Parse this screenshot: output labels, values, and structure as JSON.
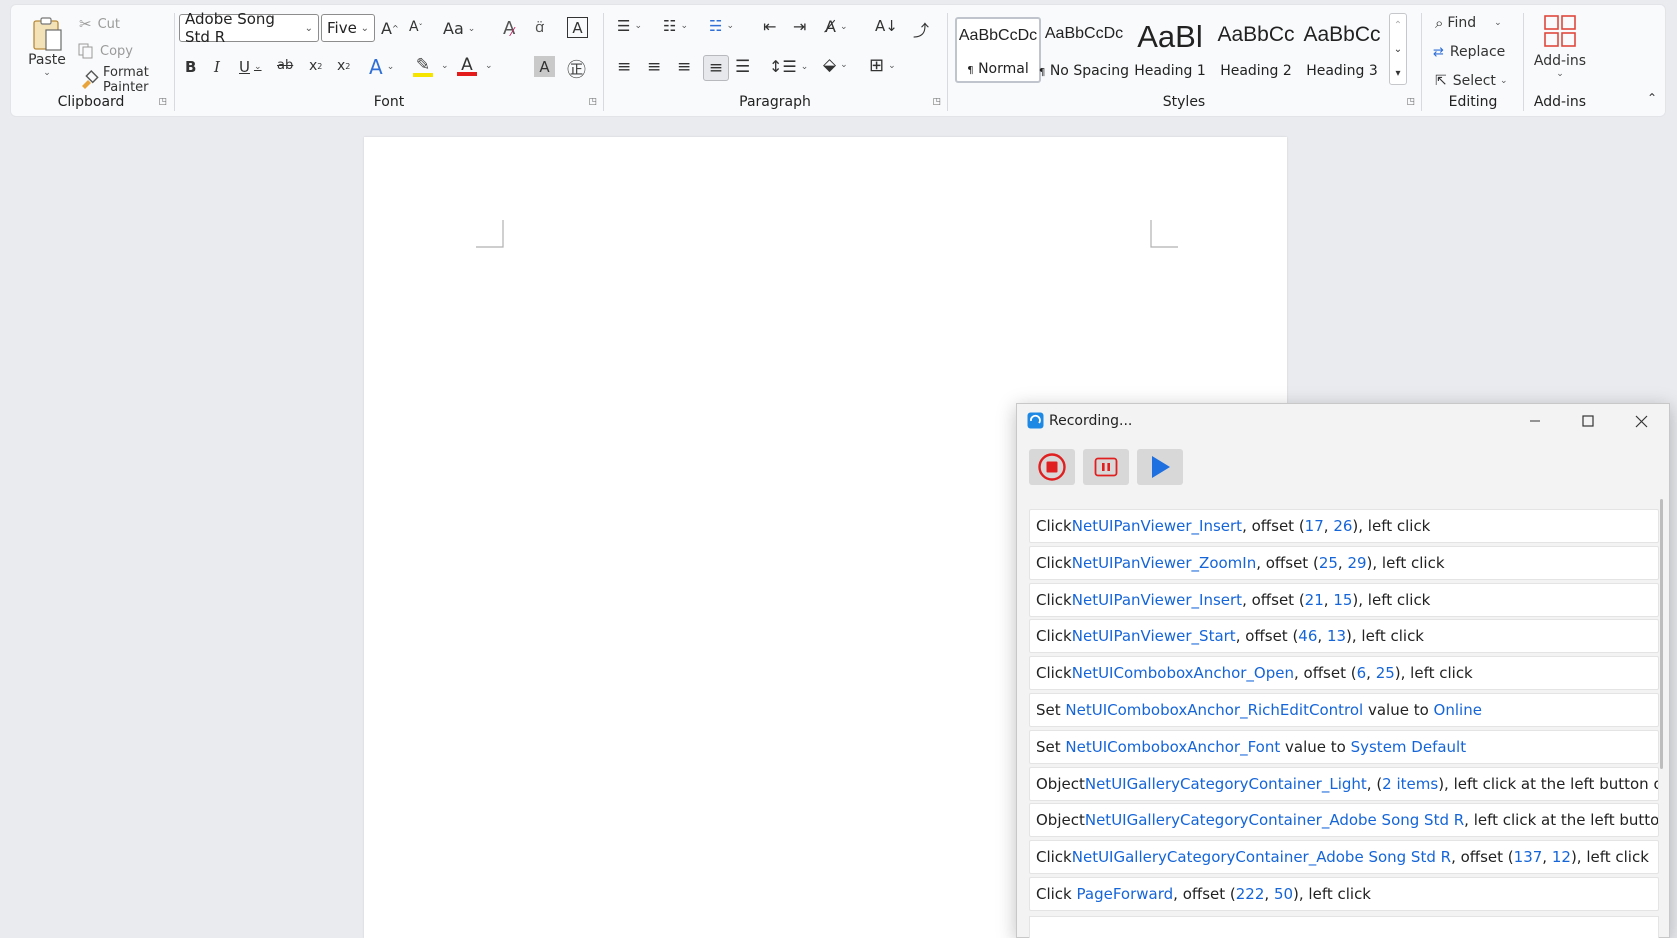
{
  "ribbon": {
    "clipboard": {
      "label": "Clipboard",
      "paste": "Paste",
      "cut": "Cut",
      "copy": "Copy",
      "format_painter_1": "Format",
      "format_painter_2": "Painter"
    },
    "font": {
      "label": "Font",
      "font_name": "Adobe Song Std R",
      "font_size": "Five",
      "change_case": "Aa"
    },
    "paragraph": {
      "label": "Paragraph"
    },
    "styles": {
      "label": "Styles",
      "items": [
        {
          "preview": "AaBbCcDc",
          "name": "Normal",
          "marker": "¶"
        },
        {
          "preview": "AaBbCcDc",
          "name": "No Spacing",
          "marker": "¶"
        },
        {
          "preview": "AaBl",
          "name": "Heading 1"
        },
        {
          "preview": "AaBbCc",
          "name": "Heading 2"
        },
        {
          "preview": "AaBbCc",
          "name": "Heading 3"
        }
      ]
    },
    "editing": {
      "label": "Editing",
      "find": "Find",
      "replace": "Replace",
      "select": "Select"
    },
    "addins": {
      "label": "Add-ins",
      "button": "Add-ins"
    }
  },
  "recorder": {
    "title": "Recording...",
    "rows": [
      [
        [
          "Click",
          ""
        ],
        [
          "NetUIPanViewer_Insert",
          "b"
        ],
        [
          ", offset (",
          ""
        ],
        [
          "17",
          "b"
        ],
        [
          ", ",
          ""
        ],
        [
          "26",
          "b"
        ],
        [
          "), left click",
          ""
        ]
      ],
      [
        [
          "Click",
          ""
        ],
        [
          "NetUIPanViewer_ZoomIn",
          "b"
        ],
        [
          ", offset (",
          ""
        ],
        [
          "25",
          "b"
        ],
        [
          ", ",
          ""
        ],
        [
          "29",
          "b"
        ],
        [
          "), left click",
          ""
        ]
      ],
      [
        [
          "Click",
          ""
        ],
        [
          "NetUIPanViewer_Insert",
          "b"
        ],
        [
          ", offset (",
          ""
        ],
        [
          "21",
          "b"
        ],
        [
          ", ",
          ""
        ],
        [
          "15",
          "b"
        ],
        [
          "), left click",
          ""
        ]
      ],
      [
        [
          "Click",
          ""
        ],
        [
          "NetUIPanViewer_Start",
          "b"
        ],
        [
          ", offset (",
          ""
        ],
        [
          "46",
          "b"
        ],
        [
          ", ",
          ""
        ],
        [
          "13",
          "b"
        ],
        [
          "), left click",
          ""
        ]
      ],
      [
        [
          "Click",
          ""
        ],
        [
          "NetUIComboboxAnchor_Open",
          "b"
        ],
        [
          ", offset (",
          ""
        ],
        [
          "6",
          "b"
        ],
        [
          ", ",
          ""
        ],
        [
          "25",
          "b"
        ],
        [
          "), left click",
          ""
        ]
      ],
      [
        [
          "Set ",
          ""
        ],
        [
          "NetUIComboboxAnchor_RichEditControl",
          "b"
        ],
        [
          " value to ",
          ""
        ],
        [
          "Online",
          "b"
        ]
      ],
      [
        [
          "Set ",
          ""
        ],
        [
          "NetUIComboboxAnchor_Font",
          "b"
        ],
        [
          " value to ",
          ""
        ],
        [
          "System Default",
          "b"
        ]
      ],
      [
        [
          "Object",
          ""
        ],
        [
          "NetUIGalleryCategoryContainer_Light",
          "b"
        ],
        [
          ", (",
          ""
        ],
        [
          "2 items",
          "b"
        ],
        [
          "), left click at the left button of the...",
          ""
        ]
      ],
      [
        [
          "Object",
          ""
        ],
        [
          "NetUIGalleryCategoryContainer_Adobe Song Std R",
          "b"
        ],
        [
          ", left click at the left button of t...",
          ""
        ]
      ],
      [
        [
          "Click",
          ""
        ],
        [
          "NetUIGalleryCategoryContainer_Adobe Song Std R",
          "b"
        ],
        [
          ", offset (",
          ""
        ],
        [
          "137",
          "b"
        ],
        [
          ", ",
          ""
        ],
        [
          "12",
          "b"
        ],
        [
          "), left click",
          ""
        ]
      ],
      [
        [
          "Click ",
          ""
        ],
        [
          "PageForward",
          "b"
        ],
        [
          ", offset (",
          ""
        ],
        [
          "222",
          "b"
        ],
        [
          ", ",
          ""
        ],
        [
          "50",
          "b"
        ],
        [
          "), left click",
          ""
        ]
      ]
    ]
  }
}
